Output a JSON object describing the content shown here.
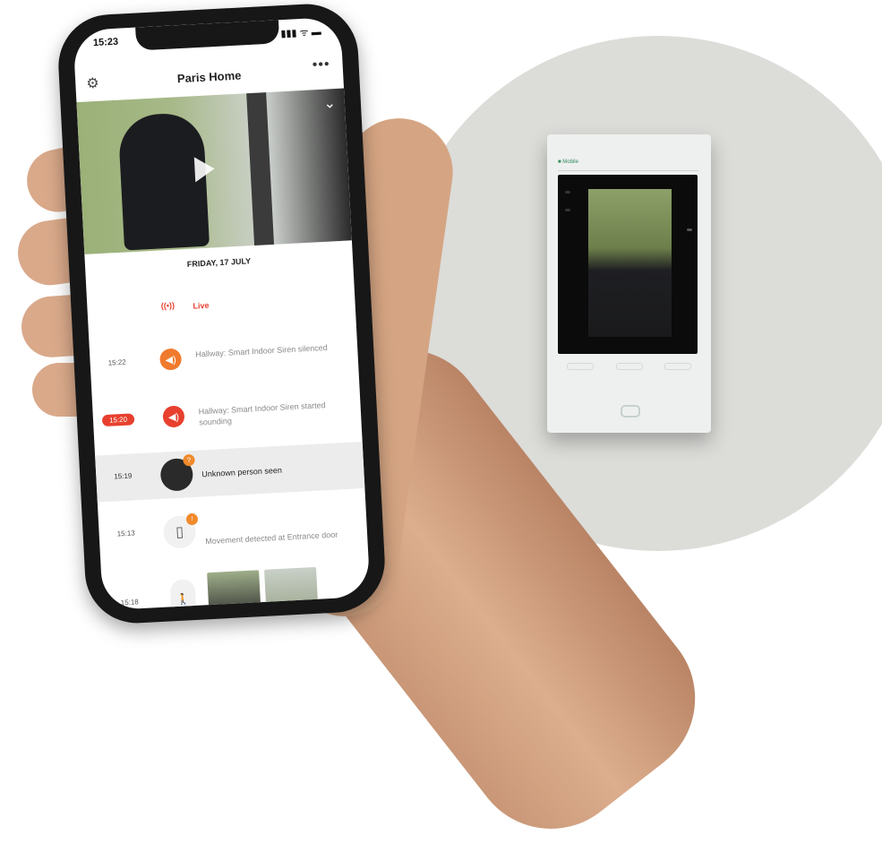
{
  "phone": {
    "status_time": "15:23",
    "status_icons": "▮▮▮ ᯤ ▬",
    "header_title": "Paris Home",
    "more_label": "•••",
    "date_heading": "FRIDAY, 17 JULY",
    "events": [
      {
        "time": "",
        "icon": "live-icon",
        "text": "Live",
        "accent": "#e8402e"
      },
      {
        "time": "15:22",
        "icon": "speaker-icon",
        "text": "Hallway: Smart Indoor Siren silenced",
        "accent": "#f07a2d"
      },
      {
        "time": "15:20",
        "icon": "speaker-icon",
        "text": "Hallway: Smart Indoor Siren started sounding",
        "accent": "#e8402e"
      },
      {
        "time": "15:19",
        "icon": "person-avatar",
        "text": "Unknown person seen",
        "accent": "#f08a2b"
      },
      {
        "time": "15:13",
        "icon": "door-icon",
        "text": "Movement detected at Entrance door",
        "accent": "#f08a2b"
      },
      {
        "time": "15:18",
        "icon": "motion-icon",
        "text": "",
        "accent": "#7a7fd9"
      }
    ]
  },
  "monitor": {
    "label": "■ Mobile"
  },
  "colors": {
    "alert_red": "#e8402e",
    "alert_orange": "#f07a2d",
    "background_circle": "#dcdcd9"
  }
}
